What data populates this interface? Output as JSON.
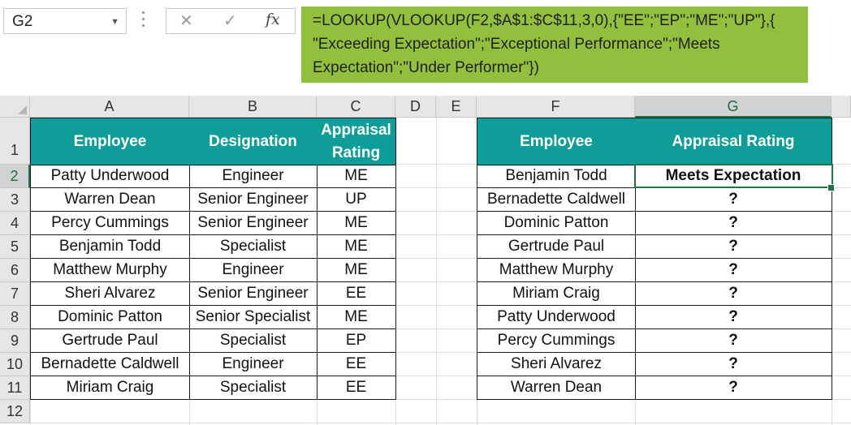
{
  "namebox": {
    "value": "G2",
    "dropdown_icon": "chevron-down-icon"
  },
  "formula_bar": {
    "cancel_icon": "close-icon",
    "enter_icon": "check-icon",
    "fx_label": "fx",
    "formula": "=LOOKUP(VLOOKUP(F2,$A$1:$C$11,3,0),{\"EE\";\"EP\";\"ME\";\"UP\"},{\n\"Exceeding Expectation\";\"Exceptional Performance\";\"Meets\nExpectation\";\"Under Performer\"})",
    "highlight_color": "#92c03d"
  },
  "columns": [
    "A",
    "B",
    "C",
    "D",
    "E",
    "F",
    "G"
  ],
  "rows": [
    "1",
    "2",
    "3",
    "4",
    "5",
    "6",
    "7",
    "8",
    "9",
    "10",
    "11",
    "12"
  ],
  "selected_cell": "G2",
  "colors": {
    "header_fill": "#0f9d9a",
    "header_text": "#ffffff",
    "selection": "#217346"
  },
  "table1": {
    "headers": [
      "Employee",
      "Designation",
      "Appraisal Rating"
    ],
    "rows": [
      [
        "Patty Underwood",
        "Engineer",
        "ME"
      ],
      [
        "Warren Dean",
        "Senior Engineer",
        "UP"
      ],
      [
        "Percy Cummings",
        "Senior Engineer",
        "ME"
      ],
      [
        "Benjamin Todd",
        "Specialist",
        "ME"
      ],
      [
        "Matthew Murphy",
        "Engineer",
        "ME"
      ],
      [
        "Sheri Alvarez",
        "Senior Engineer",
        "EE"
      ],
      [
        "Dominic Patton",
        "Senior Specialist",
        "ME"
      ],
      [
        "Gertrude Paul",
        "Specialist",
        "EP"
      ],
      [
        "Bernadette Caldwell",
        "Engineer",
        "EE"
      ],
      [
        "Miriam Craig",
        "Specialist",
        "EE"
      ]
    ]
  },
  "table2": {
    "headers": [
      "Employee",
      "Appraisal Rating"
    ],
    "rows": [
      [
        "Benjamin Todd",
        "Meets Expectation"
      ],
      [
        "Bernadette Caldwell",
        "?"
      ],
      [
        "Dominic Patton",
        "?"
      ],
      [
        "Gertrude Paul",
        "?"
      ],
      [
        "Matthew Murphy",
        "?"
      ],
      [
        "Miriam Craig",
        "?"
      ],
      [
        "Patty Underwood",
        "?"
      ],
      [
        "Percy Cummings",
        "?"
      ],
      [
        "Sheri Alvarez",
        "?"
      ],
      [
        "Warren Dean",
        "?"
      ]
    ]
  }
}
